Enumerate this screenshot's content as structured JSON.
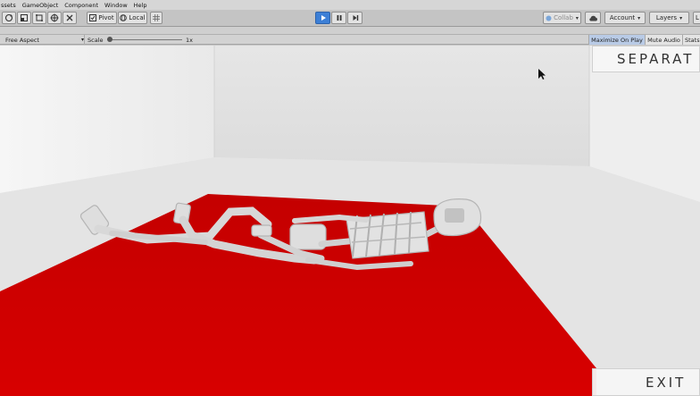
{
  "menu": [
    "ssets",
    "GameObject",
    "Component",
    "Window",
    "Help"
  ],
  "toolbar": {
    "pivot_label": "Pivot",
    "local_label": "Local",
    "collab_label": "Collab",
    "account_label": "Account",
    "layers_label": "Layers",
    "layout_label": "L"
  },
  "gameview": {
    "aspect_label": "Free Aspect",
    "scale_label": "Scale",
    "scale_value": "1x",
    "maximize_label": "Maximize On Play",
    "mute_label": "Mute Audio",
    "stats_label": "Stats"
  },
  "game_ui": {
    "separate_label": "SEPARAT",
    "exit_label": "EXIT"
  },
  "colors": {
    "play_active": "#3c7fd6",
    "floor_mat": "#cc0000",
    "skeleton": "#dcdcdc"
  }
}
